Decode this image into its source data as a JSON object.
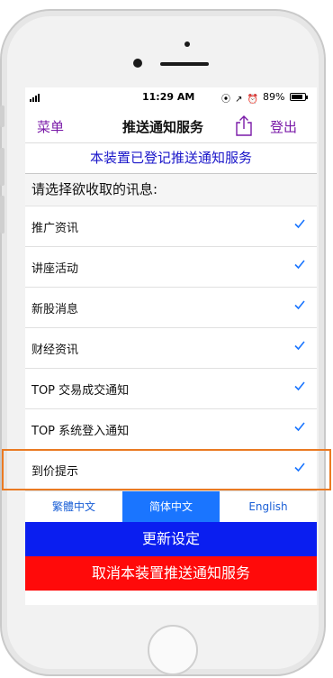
{
  "status": {
    "time": "11:29 AM",
    "icons": "⦿ ↗ ⏰",
    "battery": "89%",
    "battery_level": 0.89
  },
  "nav": {
    "menu": "菜单",
    "title": "推送通知服务",
    "logout": "登出"
  },
  "banner": "本装置已登记推送通知服务",
  "prompt": "请选择欲收取的讯息:",
  "items": [
    {
      "label": "推广资讯",
      "checked": true
    },
    {
      "label": "讲座活动",
      "checked": true
    },
    {
      "label": "新股消息",
      "checked": true
    },
    {
      "label": "财经资讯",
      "checked": true
    },
    {
      "label": "TOP 交易成交通知",
      "checked": true
    },
    {
      "label": "TOP 系统登入通知",
      "checked": true
    },
    {
      "label": "到价提示",
      "checked": true
    }
  ],
  "languages": [
    {
      "label": "繁體中文",
      "active": false
    },
    {
      "label": "简体中文",
      "active": true
    },
    {
      "label": "English",
      "active": false
    }
  ],
  "buttons": {
    "update": "更新设定",
    "cancel": "取消本装置推送通知服务"
  },
  "colors": {
    "accent": "#7a1aa8",
    "check": "#1a75ff",
    "update": "#0a1ef0",
    "cancel": "#ff0a0a",
    "highlight": "#ea7a22"
  }
}
